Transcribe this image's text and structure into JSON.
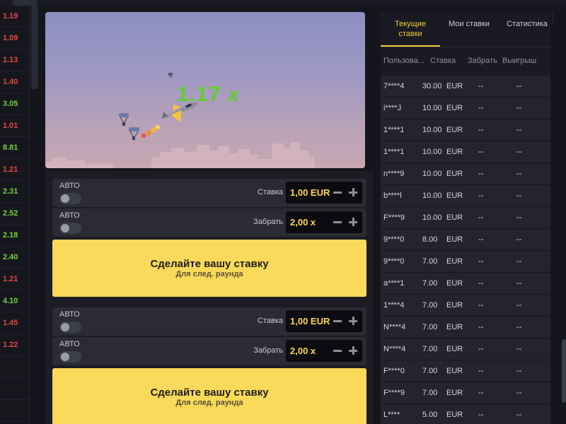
{
  "history": [
    {
      "value": "1.19",
      "color": "#e2483d"
    },
    {
      "value": "1.09",
      "color": "#e2483d"
    },
    {
      "value": "1.13",
      "color": "#e2483d"
    },
    {
      "value": "1.40",
      "color": "#e2483d"
    },
    {
      "value": "3.05",
      "color": "#6fd23a"
    },
    {
      "value": "1.01",
      "color": "#e2483d"
    },
    {
      "value": "8.81",
      "color": "#6fd23a"
    },
    {
      "value": "1.21",
      "color": "#e2483d"
    },
    {
      "value": "2.31",
      "color": "#6fd23a"
    },
    {
      "value": "2.52",
      "color": "#6fd23a"
    },
    {
      "value": "2.18",
      "color": "#6fd23a"
    },
    {
      "value": "2.40",
      "color": "#6fd23a"
    },
    {
      "value": "1.21",
      "color": "#e2483d"
    },
    {
      "value": "4.10",
      "color": "#6fd23a"
    },
    {
      "value": "1.45",
      "color": "#e2483d"
    },
    {
      "value": "1.22",
      "color": "#e2483d"
    },
    {
      "value": "",
      "color": "#e2483d"
    },
    {
      "value": "",
      "color": "#e2483d"
    },
    {
      "value": "",
      "color": "#e2483d"
    }
  ],
  "game": {
    "multiplier": "1.17",
    "multiplier_suffix": "x"
  },
  "panel1": {
    "auto1": "АВТО",
    "bet_label": "Ставка",
    "bet_value": "1,00 EUR",
    "auto2": "АВТО",
    "cashout_label": "Забрать",
    "cashout_value": "2,00 x",
    "button_main": "Сделайте вашу ставку",
    "button_sub": "Для след. раунда"
  },
  "panel2": {
    "auto1": "АВТО",
    "bet_label": "Ставка",
    "bet_value": "1,00 EUR",
    "auto2": "АВТО",
    "cashout_label": "Забрать",
    "cashout_value": "2,00 x",
    "button_main": "Сделайте вашу ставку",
    "button_sub": "Для след. раунда"
  },
  "side": {
    "tab_current": "Текущие ставки",
    "tab_my": "Мои ставки",
    "tab_stats": "Статистика",
    "col_user": "Пользова...",
    "col_bet": "Ставка",
    "col_cashout": "Забрать",
    "col_win": "Выигрыш"
  },
  "bets": [
    {
      "user": "7****4",
      "amount": "30.00",
      "currency": "EUR",
      "cashout": "--",
      "win": "--"
    },
    {
      "user": "i****J",
      "amount": "10.00",
      "currency": "EUR",
      "cashout": "--",
      "win": "--"
    },
    {
      "user": "1****1",
      "amount": "10.00",
      "currency": "EUR",
      "cashout": "--",
      "win": "--"
    },
    {
      "user": "1****1",
      "amount": "10.00",
      "currency": "EUR",
      "cashout": "--",
      "win": "--"
    },
    {
      "user": "n****9",
      "amount": "10.00",
      "currency": "EUR",
      "cashout": "--",
      "win": "--"
    },
    {
      "user": "b****l",
      "amount": "10.00",
      "currency": "EUR",
      "cashout": "--",
      "win": "--"
    },
    {
      "user": "F****9",
      "amount": "10.00",
      "currency": "EUR",
      "cashout": "--",
      "win": "--"
    },
    {
      "user": "9****0",
      "amount": "8.00",
      "currency": "EUR",
      "cashout": "--",
      "win": "--"
    },
    {
      "user": "9****0",
      "amount": "7.00",
      "currency": "EUR",
      "cashout": "--",
      "win": "--"
    },
    {
      "user": "a****1",
      "amount": "7.00",
      "currency": "EUR",
      "cashout": "--",
      "win": "--"
    },
    {
      "user": "1****4",
      "amount": "7.00",
      "currency": "EUR",
      "cashout": "--",
      "win": "--"
    },
    {
      "user": "N****4",
      "amount": "7.00",
      "currency": "EUR",
      "cashout": "--",
      "win": "--"
    },
    {
      "user": "N****4",
      "amount": "7.00",
      "currency": "EUR",
      "cashout": "--",
      "win": "--"
    },
    {
      "user": "F****0",
      "amount": "7.00",
      "currency": "EUR",
      "cashout": "--",
      "win": "--"
    },
    {
      "user": "F****9",
      "amount": "7.00",
      "currency": "EUR",
      "cashout": "--",
      "win": "--"
    },
    {
      "user": "L****",
      "amount": "5.00",
      "currency": "EUR",
      "cashout": "--",
      "win": "--"
    }
  ]
}
